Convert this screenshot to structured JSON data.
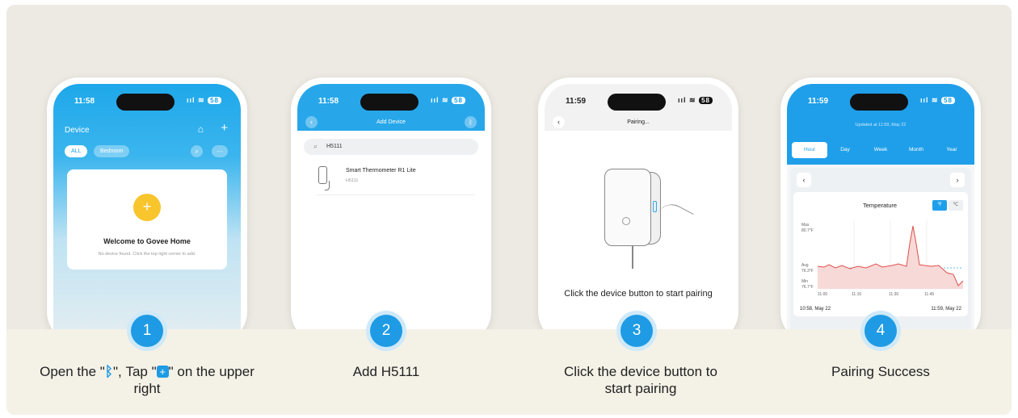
{
  "steps": [
    {
      "number": "1",
      "caption_parts": [
        "Open the \"",
        "\", Tap \"",
        "\" on the upper right"
      ],
      "screen": {
        "time": "11:58",
        "title": "Device",
        "chips": [
          "ALL",
          "Bedroom"
        ],
        "welcome_title": "Welcome to Govee Home",
        "welcome_sub": "No device found. Click the top right corner to add."
      }
    },
    {
      "number": "2",
      "caption": "Add H5111",
      "screen": {
        "time": "11:58",
        "title": "Add Device",
        "search_value": "H5111",
        "device_name": "Smart Thermometer R1 Lite",
        "device_model": "H5111"
      }
    },
    {
      "number": "3",
      "caption": "Click the device button to start pairing",
      "screen": {
        "time": "11:59",
        "title": "Pairing...",
        "message": "Click the device button to start pairing"
      }
    },
    {
      "number": "4",
      "caption": "Pairing Success",
      "screen": {
        "time": "11:59",
        "updated": "Updated at 11:59, May 22",
        "tabs": [
          "Hour",
          "Day",
          "Week",
          "Month",
          "Year"
        ],
        "chart_title": "Temperature",
        "unit_f": "℉",
        "unit_c": "℃",
        "max_label": "Max",
        "max_value": "80.7°F",
        "avg_label": "Avg",
        "avg_value": "76.3°F",
        "min_label": "Min",
        "min_value": "76.7°F",
        "x_ticks": [
          "11:00",
          "11:15",
          "11:30",
          "11:45"
        ],
        "range_start": "10:58,  May 22",
        "range_end": "11:59,  May 22"
      }
    }
  ],
  "icons": {
    "bluetooth": "bluetooth-icon",
    "plus": "plus-icon"
  },
  "colors": {
    "accent": "#1e9be4",
    "yellow": "#f8c52c",
    "chart_line": "#e0504a"
  },
  "status": {
    "signal": "::!",
    "wifi": "◠",
    "battery": "5G"
  }
}
